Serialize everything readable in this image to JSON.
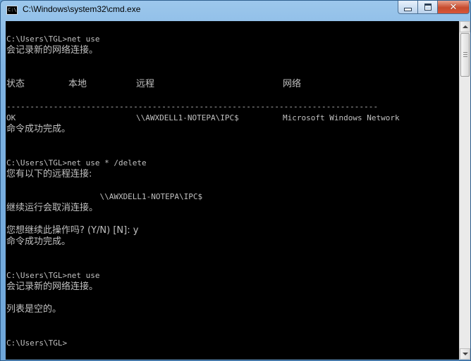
{
  "window": {
    "title": "C:\\Windows\\system32\\cmd.exe",
    "app_icon": "C:\\",
    "controls": {
      "close": "✕"
    }
  },
  "console": {
    "lines": [
      "C:\\Users\\TGL>net use",
      "会记录新的网络连接。",
      "C:\\Users\\TGL>net use * /delete",
      "您有以下的远程连接:",
      "                    \\\\AWXDELL1-NOTEPA\\IPC$",
      "继续运行会取消连接。",
      "您想继续此操作吗? (Y/N) [N]: y",
      "命令成功完成。",
      "C:\\Users\\TGL>net use",
      "会记录新的网络连接。",
      "列表是空的。",
      "C:\\Users\\TGL>"
    ],
    "table": {
      "headers": [
        "状态",
        "本地",
        "远程",
        "网络"
      ],
      "separator": "-------------------------------------------------------------------------------",
      "row": [
        "OK",
        "",
        "\\\\AWXDELL1-NOTEPA\\IPC$",
        "Microsoft Windows Network"
      ],
      "result": "命令成功完成。"
    }
  }
}
